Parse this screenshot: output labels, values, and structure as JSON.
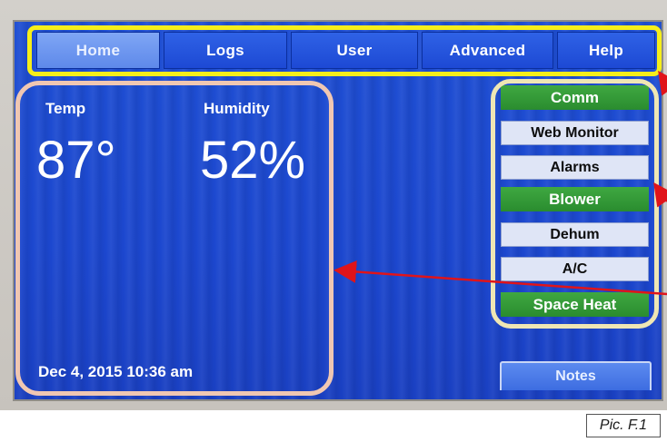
{
  "nav": {
    "tabs": [
      {
        "label": "Home",
        "active": true
      },
      {
        "label": "Logs",
        "active": false
      },
      {
        "label": "User",
        "active": false
      },
      {
        "label": "Advanced",
        "active": false
      },
      {
        "label": "Help",
        "active": false
      }
    ]
  },
  "readings": {
    "temp_label": "Temp",
    "temp_value": "87°",
    "humidity_label": "Humidity",
    "humidity_value": "52%",
    "datetime": "Dec 4, 2015  10:36 am"
  },
  "controls": {
    "items": [
      {
        "label": "Comm",
        "type": "group"
      },
      {
        "label": "Web Monitor",
        "type": "item"
      },
      {
        "label": "Alarms",
        "type": "item"
      },
      {
        "label": "Blower",
        "type": "group"
      },
      {
        "label": "Dehum",
        "type": "item"
      },
      {
        "label": "A/C",
        "type": "item"
      },
      {
        "label": "Space Heat",
        "type": "group"
      }
    ],
    "notes_label": "Notes"
  },
  "caption": "Pic. F.1",
  "colors": {
    "screen_blue": "#1f4fd3",
    "group_green": "#3fa841",
    "nav_highlight": "#f6ee1a",
    "panel_highlight": "#f0c7b2",
    "controls_highlight": "#efe6b4",
    "arrow_red": "#e0141a"
  }
}
